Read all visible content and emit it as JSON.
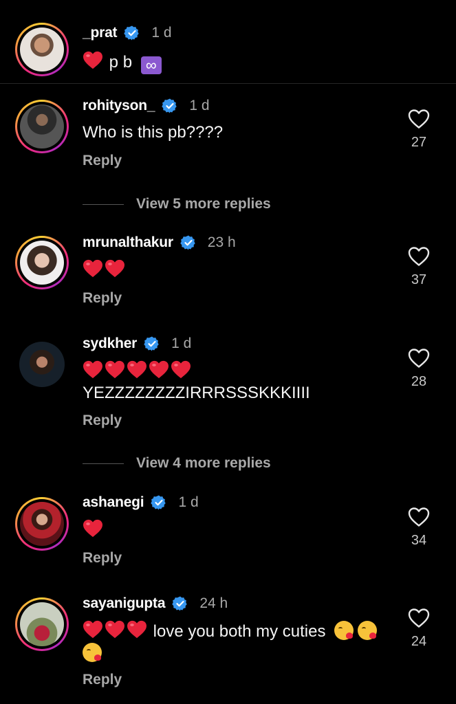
{
  "colors": {
    "background": "#000000",
    "verified": "#3797f0",
    "heart_emoji": "#e8243c",
    "secondary_text": "#a8a8a8"
  },
  "caption": {
    "username": "_prat",
    "time": "1 d",
    "text": "p b",
    "emoji": [
      "red-heart",
      "infinity"
    ]
  },
  "comments": [
    {
      "username": "rohityson_",
      "time": "1 d",
      "text": "Who is this pb????",
      "reply": "Reply",
      "likes": "27",
      "view_more": "View 5 more replies"
    },
    {
      "username": "mrunalthakur",
      "time": "23 h",
      "text": "",
      "emoji_hearts": 2,
      "reply": "Reply",
      "likes": "37"
    },
    {
      "username": "sydkher",
      "time": "1 d",
      "text": "YEZZZZZZZZIRRRSSSKKKIIII",
      "emoji_hearts": 5,
      "reply": "Reply",
      "likes": "28",
      "view_more": "View 4 more replies"
    },
    {
      "username": "ashanegi",
      "time": "1 d",
      "text": "",
      "emoji_hearts": 1,
      "reply": "Reply",
      "likes": "34"
    },
    {
      "username": "sayanigupta",
      "time": "24 h",
      "text": "love you both my cuties",
      "emoji_hearts": 3,
      "emoji_kiss": 3,
      "reply": "Reply",
      "likes": "24"
    }
  ]
}
